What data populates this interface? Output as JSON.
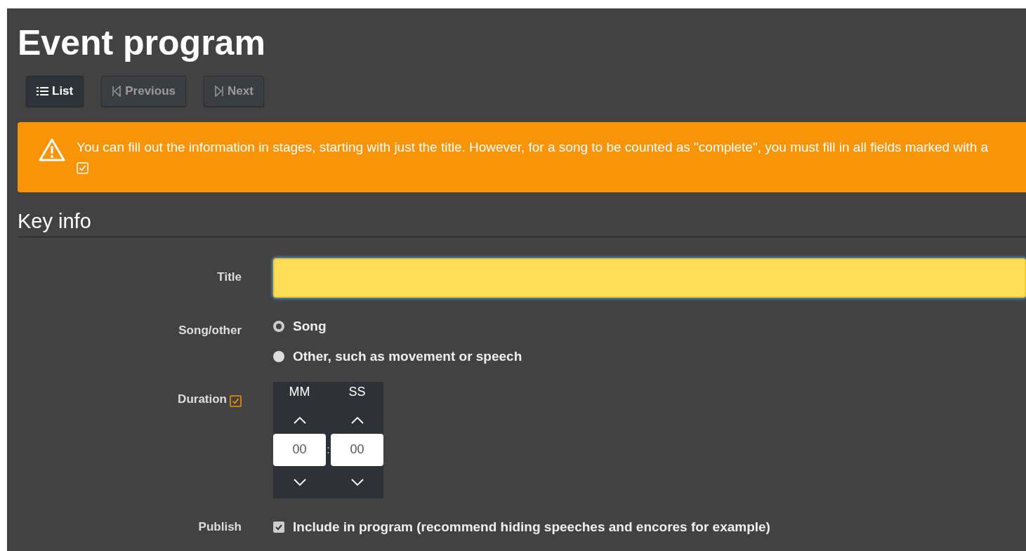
{
  "page": {
    "title": "Event program"
  },
  "toolbar": [
    {
      "label": "List",
      "kind": "list",
      "disabled": false
    },
    {
      "label": "Previous",
      "kind": "previous",
      "disabled": true
    },
    {
      "label": "Next",
      "kind": "next",
      "disabled": true
    }
  ],
  "alert": {
    "text": "You can fill out the information in stages, starting with just the title. However, for a song to be counted as \"complete\", you must fill in all fields marked with a"
  },
  "section": {
    "title": "Key info"
  },
  "form": [
    {
      "kind": "text",
      "label": "Title",
      "required": false
    },
    {
      "kind": "radio",
      "label": "Song/other",
      "required": false,
      "options": [
        {
          "label": "Song",
          "selected": true
        },
        {
          "label": "Other, such as movement or speech",
          "selected": false
        }
      ]
    },
    {
      "kind": "time",
      "label": "Duration",
      "required": true,
      "columns": [
        {
          "header": "MM",
          "value": "00"
        },
        {
          "header": "SS",
          "value": "00"
        }
      ],
      "separator": ":"
    },
    {
      "kind": "checkbox",
      "label": "Publish",
      "required": false,
      "option": {
        "label": "Include in program (recommend hiding speeches and encores for example)",
        "checked": true
      }
    }
  ]
}
